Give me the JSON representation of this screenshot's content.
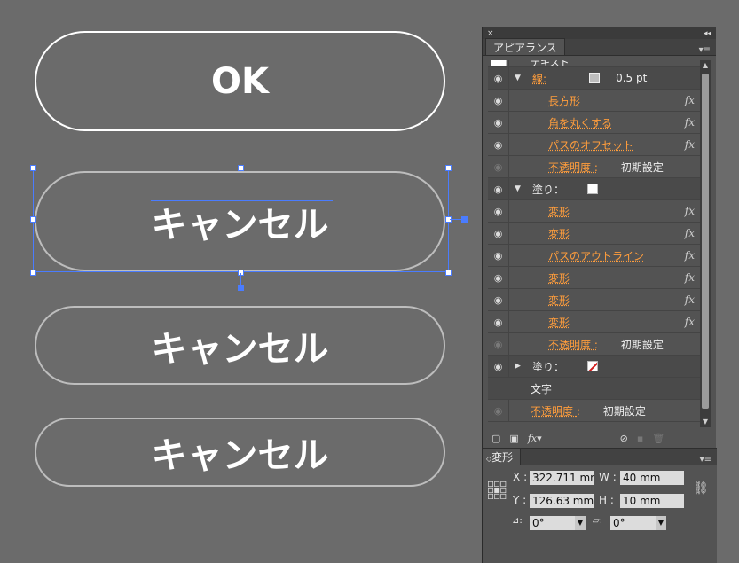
{
  "canvas": {
    "ok_label": "OK",
    "cancel_label_1": "キャンセル",
    "cancel_label_2": "キャンセル",
    "cancel_label_3": "キャンセル"
  },
  "panel": {
    "close_glyph": "×",
    "collapse_glyph": "◂◂",
    "tab": "アピアランス",
    "menu_glyph": "▾≡",
    "rows": {
      "r0_text": "テキスト",
      "r1_label": "線",
      "r1_colon": ":",
      "r1_value": "0.5 pt",
      "r2": "長方形",
      "r3": "角を丸くする",
      "r4": "パスのオフセット",
      "r5_label": "不透明度",
      "r5_colon": ":",
      "r5_value": "初期設定",
      "r6_label": "塗り",
      "r6_colon": "：",
      "r7": "変形",
      "r8": "変形",
      "r9": "パスのアウトライン",
      "r10": "変形",
      "r11": "変形",
      "r12": "変形",
      "r13_label": "不透明度",
      "r13_colon": ":",
      "r13_value": "初期設定",
      "r14_label": "塗り",
      "r14_colon": "：",
      "r15": "文字",
      "r16_label": "不透明度",
      "r16_colon": ":",
      "r16_value": "初期設定"
    },
    "fx": "fx"
  },
  "transform": {
    "tab": "変形",
    "x_label": "X",
    "x_value": "322.711 mm",
    "y_label": "Y",
    "y_value": "126.63 mm",
    "w_label": "W",
    "w_value": "40 mm",
    "h_label": "H",
    "h_value": "10 mm",
    "rotate_value": "0°",
    "shear_value": "0°",
    "colon": ":"
  }
}
